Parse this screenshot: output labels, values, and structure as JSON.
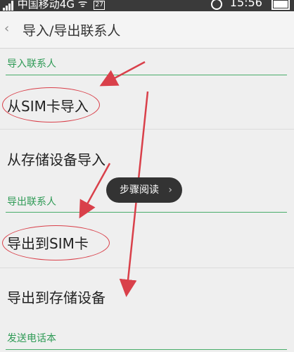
{
  "status_bar": {
    "carrier": "中国移动4G",
    "time": "15:56",
    "sim_badge": "27"
  },
  "header": {
    "back_icon": "chevron-left-icon",
    "title": "导入/导出联系人"
  },
  "sections": [
    {
      "header": "导入联系人",
      "items": [
        "从SIM卡导入",
        "从存储设备导入"
      ]
    },
    {
      "header": "导出联系人",
      "items": [
        "导出到SIM卡",
        "导出到存储设备"
      ]
    },
    {
      "header": "发送电话本",
      "items": []
    }
  ],
  "toast": {
    "label": "步骤阅读",
    "icon": "chevron-right-icon"
  },
  "colors": {
    "section_green": "#2e9a55",
    "annotation_red": "#d9404a",
    "status_bar_bg": "#3a3a3a",
    "background": "#efefef"
  }
}
